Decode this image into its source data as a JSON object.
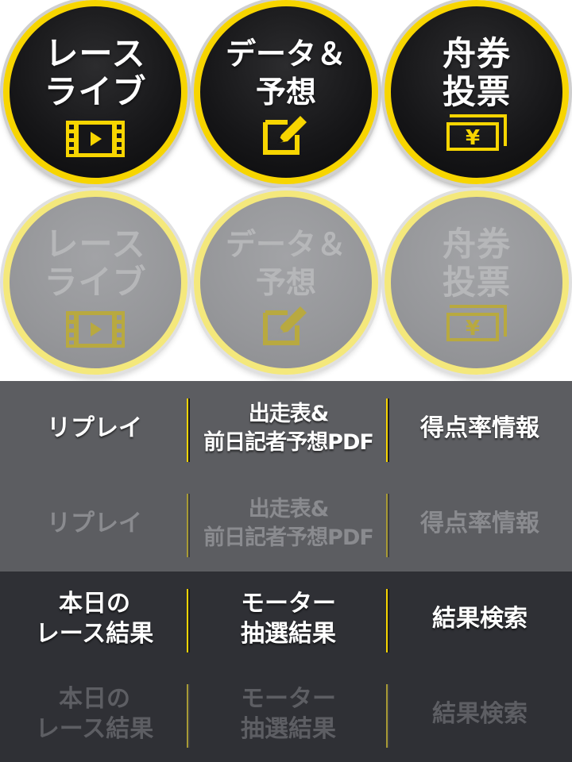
{
  "circle_buttons": {
    "active": [
      {
        "label": "レース\nライブ",
        "icon": "film-play-icon"
      },
      {
        "label": "データ＆\n予想",
        "icon": "edit-note-icon"
      },
      {
        "label": "舟券\n投票",
        "icon": "yen-ticket-icon"
      }
    ],
    "inactive": [
      {
        "label": "レース\nライブ",
        "icon": "film-play-icon"
      },
      {
        "label": "データ＆\n予想",
        "icon": "edit-note-icon"
      },
      {
        "label": "舟券\n投票",
        "icon": "yen-ticket-icon"
      }
    ]
  },
  "text_buttons_a": {
    "active": [
      "リプレイ",
      "出走表&\n前日記者予想PDF",
      "得点率情報"
    ],
    "inactive": [
      "リプレイ",
      "出走表&\n前日記者予想PDF",
      "得点率情報"
    ]
  },
  "text_buttons_b": {
    "active": [
      "本日の\nレース結果",
      "モーター\n抽選結果",
      "結果検索"
    ],
    "inactive": [
      "本日の\nレース結果",
      "モーター\n抽選結果",
      "結果検索"
    ]
  },
  "colors": {
    "accent_yellow": "#f7d500",
    "active_circle_bg": "#161618",
    "inactive_circle_bg": "#96979a",
    "light_row_bg": "#5c5d61",
    "dark_row_bg": "#2f3035"
  }
}
